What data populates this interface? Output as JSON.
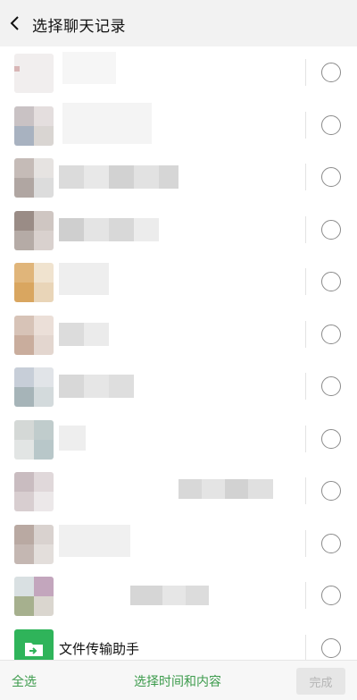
{
  "header": {
    "title": "选择聊天记录",
    "back_icon": "chevron-left-icon"
  },
  "list": {
    "items": [
      {
        "name": "",
        "selected": false
      },
      {
        "name": "",
        "selected": false
      },
      {
        "name": "",
        "selected": false
      },
      {
        "name": "",
        "selected": false
      },
      {
        "name": "",
        "selected": false
      },
      {
        "name": "",
        "selected": false
      },
      {
        "name": "",
        "selected": false
      },
      {
        "name": "",
        "selected": false
      },
      {
        "name": "",
        "selected": false
      },
      {
        "name": "",
        "selected": false
      },
      {
        "name": "",
        "selected": false
      },
      {
        "name": "文件传输助手",
        "selected": false,
        "icon": "folder-transfer-icon"
      }
    ]
  },
  "footer": {
    "select_all_label": "全选",
    "select_time_label": "选择时间和内容",
    "done_label": "完成"
  },
  "colors": {
    "accent_green": "#3c9b4c",
    "file_avatar_green": "#2fb45a",
    "header_bg": "#f2f2f2"
  }
}
